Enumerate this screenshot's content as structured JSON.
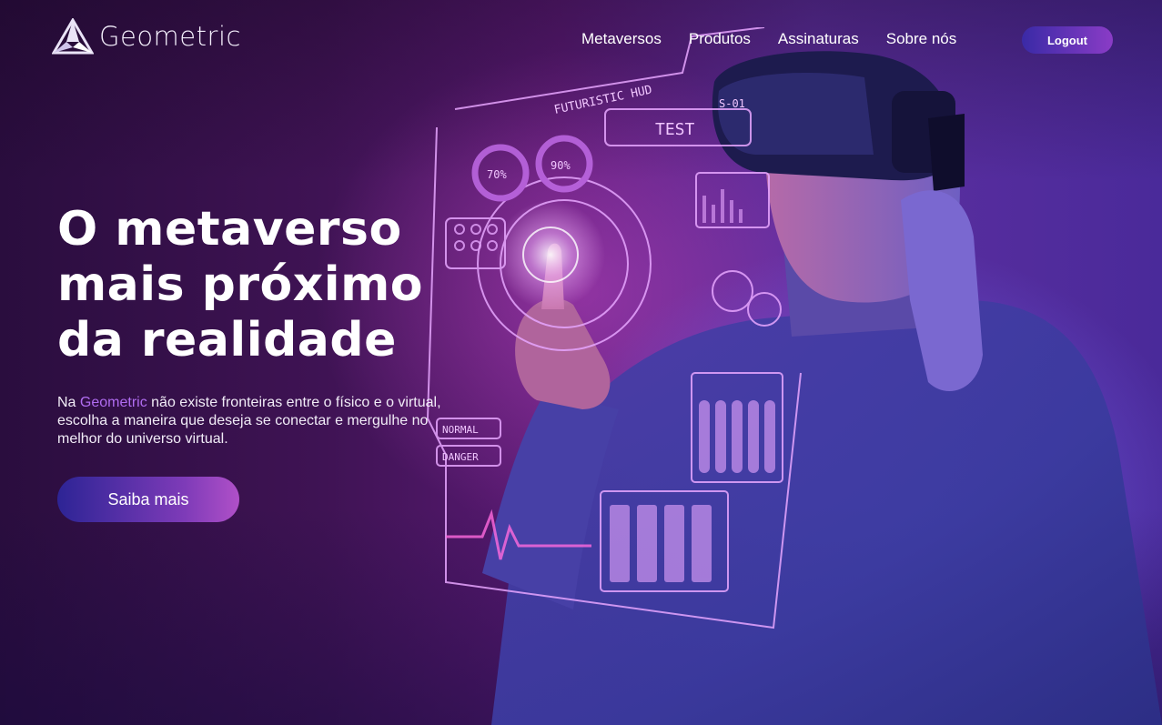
{
  "brand": {
    "name": "Geometric",
    "logo_icon": "triangle-logo-icon"
  },
  "nav": {
    "items": [
      {
        "label": "Metaversos"
      },
      {
        "label": "Produtos"
      },
      {
        "label": "Assinaturas"
      },
      {
        "label": "Sobre nós"
      }
    ],
    "logout_label": "Logout"
  },
  "hero": {
    "headline_lines": [
      "O metaverso",
      "mais próximo",
      "da realidade"
    ],
    "description_before": "Na ",
    "description_highlight": "Geometric",
    "description_after": " não existe fronteiras entre o físico e o virtual, escolha a maneira que deseja se conectar e mergulhe no melhor do universo virtual.",
    "cta_label": "Saiba mais"
  },
  "hud": {
    "title": "FUTURISTIC HUD",
    "test_label": "TEST",
    "code_label": "S-01",
    "gauge_1": "70%",
    "gauge_2": "90%",
    "normal_label": "NORMAL",
    "danger_label": "DANGER"
  },
  "colors": {
    "accent": "#b06cf0",
    "button_start": "#2d2495",
    "button_end": "#b050c8",
    "hud_line": "#e7a6ff"
  }
}
